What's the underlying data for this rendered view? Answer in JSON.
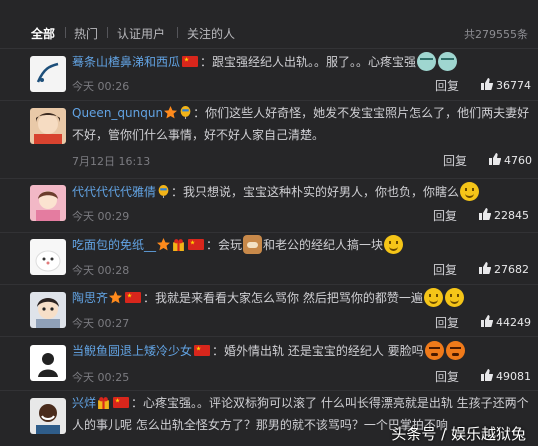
{
  "tabs": [
    "全部",
    "热门",
    "认证用户",
    "关注的人"
  ],
  "total_label": "共279555条",
  "reply_label": "回复",
  "comments": [
    {
      "user": "蓦条山楂鼻涕和西瓜",
      "text": "：跟宝强经纪人出轨。。服了。。心疼宝强",
      "time": "今天 00:26",
      "likes": "36774"
    },
    {
      "user": "Queen_qunqun",
      "text": "：你们这些人好奇怪，她发不发宝宝照片怎么了，他们两夫妻好",
      "text2": "不好，管你们什么事情，好不好人家自己清楚。",
      "time": "7月12日 16:13",
      "likes": "4760"
    },
    {
      "user": "代代代代代雅倩",
      "text": "：我只想说，宝宝这种朴实的好男人，你也负，你瞎么",
      "time": "今天 00:29",
      "likes": "22845"
    },
    {
      "user": "吃面包的免纸__",
      "text": "：会玩",
      "text_b": "和老公的经纪人搞一块",
      "time": "今天 00:28",
      "likes": "27682"
    },
    {
      "user": "陶思齐",
      "text": "：我就是来看看大家怎么骂你 然后把骂你的都赞一遍",
      "time": "今天 00:27",
      "likes": "44249"
    },
    {
      "user": "当鲵鱼圆退上矮冷少女",
      "text": "：婚外情出轨 还是宝宝的经纪人 要脸吗",
      "time": "今天 00:25",
      "likes": "49081"
    },
    {
      "user": "兴烊",
      "text": "：心疼宝强。。评论双标狗可以滚了 什么叫长得漂亮就是出轨 生孩子还两个",
      "text2": "人的事儿呢 怎么出轨全怪女方了？那男的就不该骂吗？一个巴掌拍不响"
    }
  ],
  "watermark": "头条号 / 娱乐越狱兔",
  "colors": {
    "background": "#262628",
    "username": "#62a3e3",
    "meta": "#7b7b80"
  }
}
